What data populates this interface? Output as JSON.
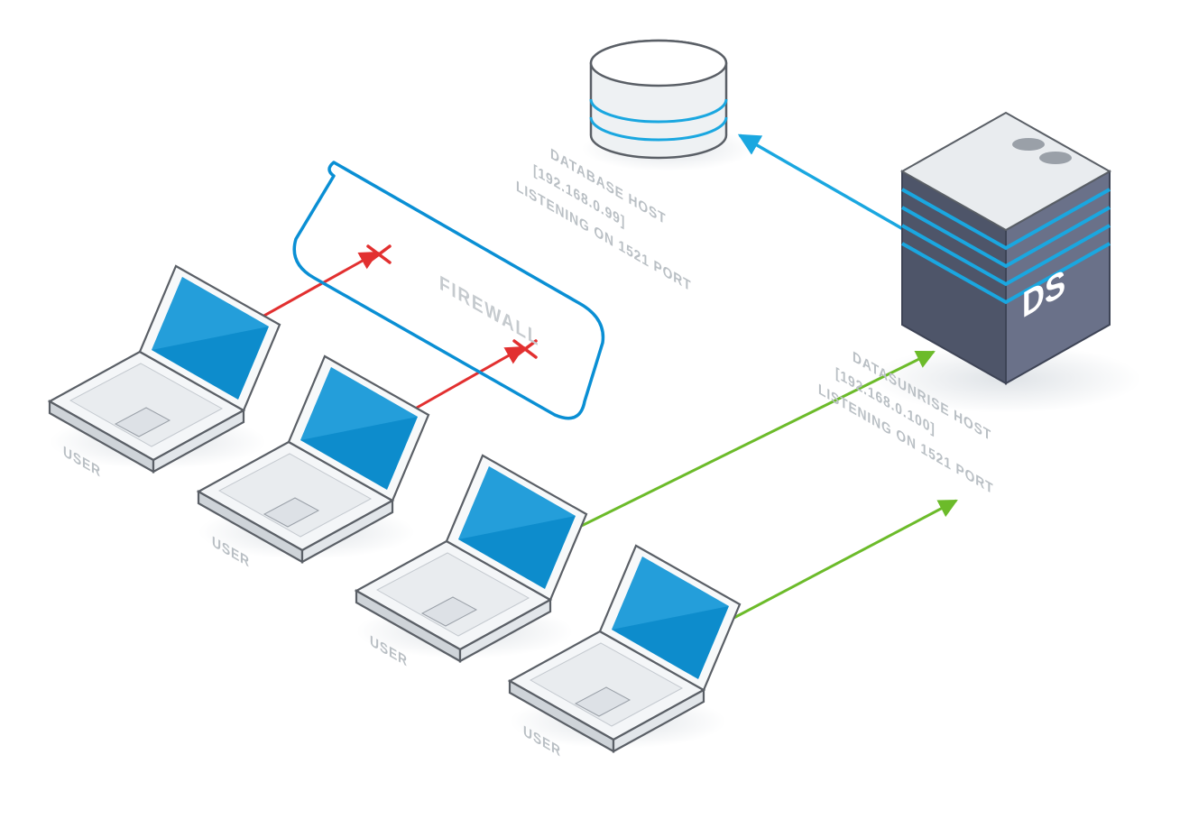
{
  "labels": {
    "user1": "USER",
    "user2": "USER",
    "user3": "USER",
    "user4": "USER",
    "firewall": "FIREWALL",
    "db_line1": "DATABASE HOST",
    "db_line2": "[192.168.0.99]",
    "db_line3": "LISTENING ON 1521 PORT",
    "ds_line1": "DATASUNRISE HOST",
    "ds_line2": "[192.168.0.100]",
    "ds_line3": "LISTENING ON 1521 PORT",
    "server_badge": "DS"
  },
  "colors": {
    "outline": "#5a5f66",
    "screen": "#0d8ccc",
    "screen_light": "#3cb0e8",
    "label": "#b9bfc4",
    "firewall_stroke": "#0a8fd4",
    "red": "#e23030",
    "green": "#6cbb2a",
    "cyan": "#1aa7e0",
    "server_body": "#5d6478",
    "server_edge": "#3e4456",
    "shadow": "#e9ecef"
  }
}
